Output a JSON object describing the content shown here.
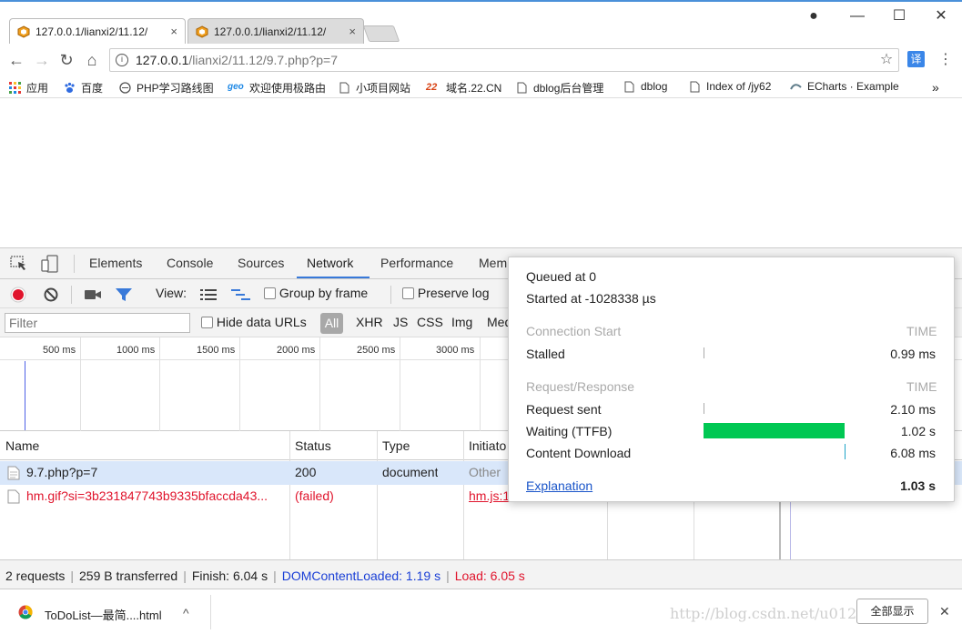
{
  "browser": {
    "tabs": [
      {
        "title": "127.0.0.1/lianxi2/11.12/",
        "close": "×",
        "active": true
      },
      {
        "title": "127.0.0.1/lianxi2/11.12/",
        "close": "×",
        "active": false
      }
    ],
    "address": {
      "info": "i",
      "host": "127.0.0.1",
      "path": "/lianxi2/11.12/9.7.php?p=7",
      "star": "☆",
      "translate": "译",
      "menu": "⋮"
    },
    "nav": {
      "back": "←",
      "forward": "→",
      "reload": "↻",
      "home": "⌂"
    },
    "window": {
      "account": "●",
      "minimize": "—",
      "maximize": "☐",
      "close": "✕"
    }
  },
  "bookmarks": [
    {
      "label": "应用"
    },
    {
      "label": "百度"
    },
    {
      "label": "PHP学习路线图"
    },
    {
      "label": "欢迎使用极路由"
    },
    {
      "label": "小项目网站"
    },
    {
      "label": "域名.22.CN"
    },
    {
      "label": "dblog后台管理"
    },
    {
      "label": "dblog"
    },
    {
      "label": "Index of /jy62"
    },
    {
      "label": "ECharts · Example"
    }
  ],
  "bookmarks_more": "»",
  "devtools": {
    "tabs": [
      "Elements",
      "Console",
      "Sources",
      "Network",
      "Performance",
      "Mem"
    ],
    "selected_tab": "Network",
    "toolbar": {
      "view_label": "View:",
      "group_by_frame": "Group by frame",
      "preserve_log": "Preserve log"
    },
    "filter": {
      "placeholder": "Filter",
      "hide_data_urls": "Hide data URLs",
      "types": [
        "All",
        "XHR",
        "JS",
        "CSS",
        "Img",
        "Med"
      ]
    },
    "timeline_ticks": [
      "500 ms",
      "1000 ms",
      "1500 ms",
      "2000 ms",
      "2500 ms",
      "3000 ms"
    ],
    "columns": [
      "Name",
      "Status",
      "Type",
      "Initiato"
    ],
    "rows": [
      {
        "name": "9.7.php?p=7",
        "status": "200",
        "type": "document",
        "initiator": "Other",
        "failed": false
      },
      {
        "name": "hm.gif?si=3b231847743b9335bfaccda43...",
        "status": "(failed)",
        "type": "",
        "initiator": "hm.js:1",
        "failed": true
      }
    ],
    "status": {
      "requests": "2 requests",
      "transferred": "259 B transferred",
      "finish": "Finish: 6.04 s",
      "dom_loaded": "DOMContentLoaded: 1.19 s",
      "load": "Load: 6.05 s"
    },
    "timing_popover": {
      "queued": "Queued at 0",
      "started": "Started at -1028338 µs",
      "section1": {
        "title": "Connection Start",
        "time_label": "TIME"
      },
      "stalled": {
        "label": "Stalled",
        "time": "0.99 ms"
      },
      "section2": {
        "title": "Request/Response",
        "time_label": "TIME"
      },
      "request_sent": {
        "label": "Request sent",
        "time": "2.10 ms"
      },
      "waiting": {
        "label": "Waiting (TTFB)",
        "time": "1.02 s"
      },
      "content_download": {
        "label": "Content Download",
        "time": "6.08 ms"
      },
      "explanation": "Explanation",
      "total": "1.03 s",
      "bar_color": "#00c853"
    }
  },
  "downloads": {
    "file": "ToDoList—最简....html",
    "chevron": "^",
    "show_all": "全部显示",
    "close": "✕"
  },
  "watermark": "http://blog.csdn.net/u012"
}
